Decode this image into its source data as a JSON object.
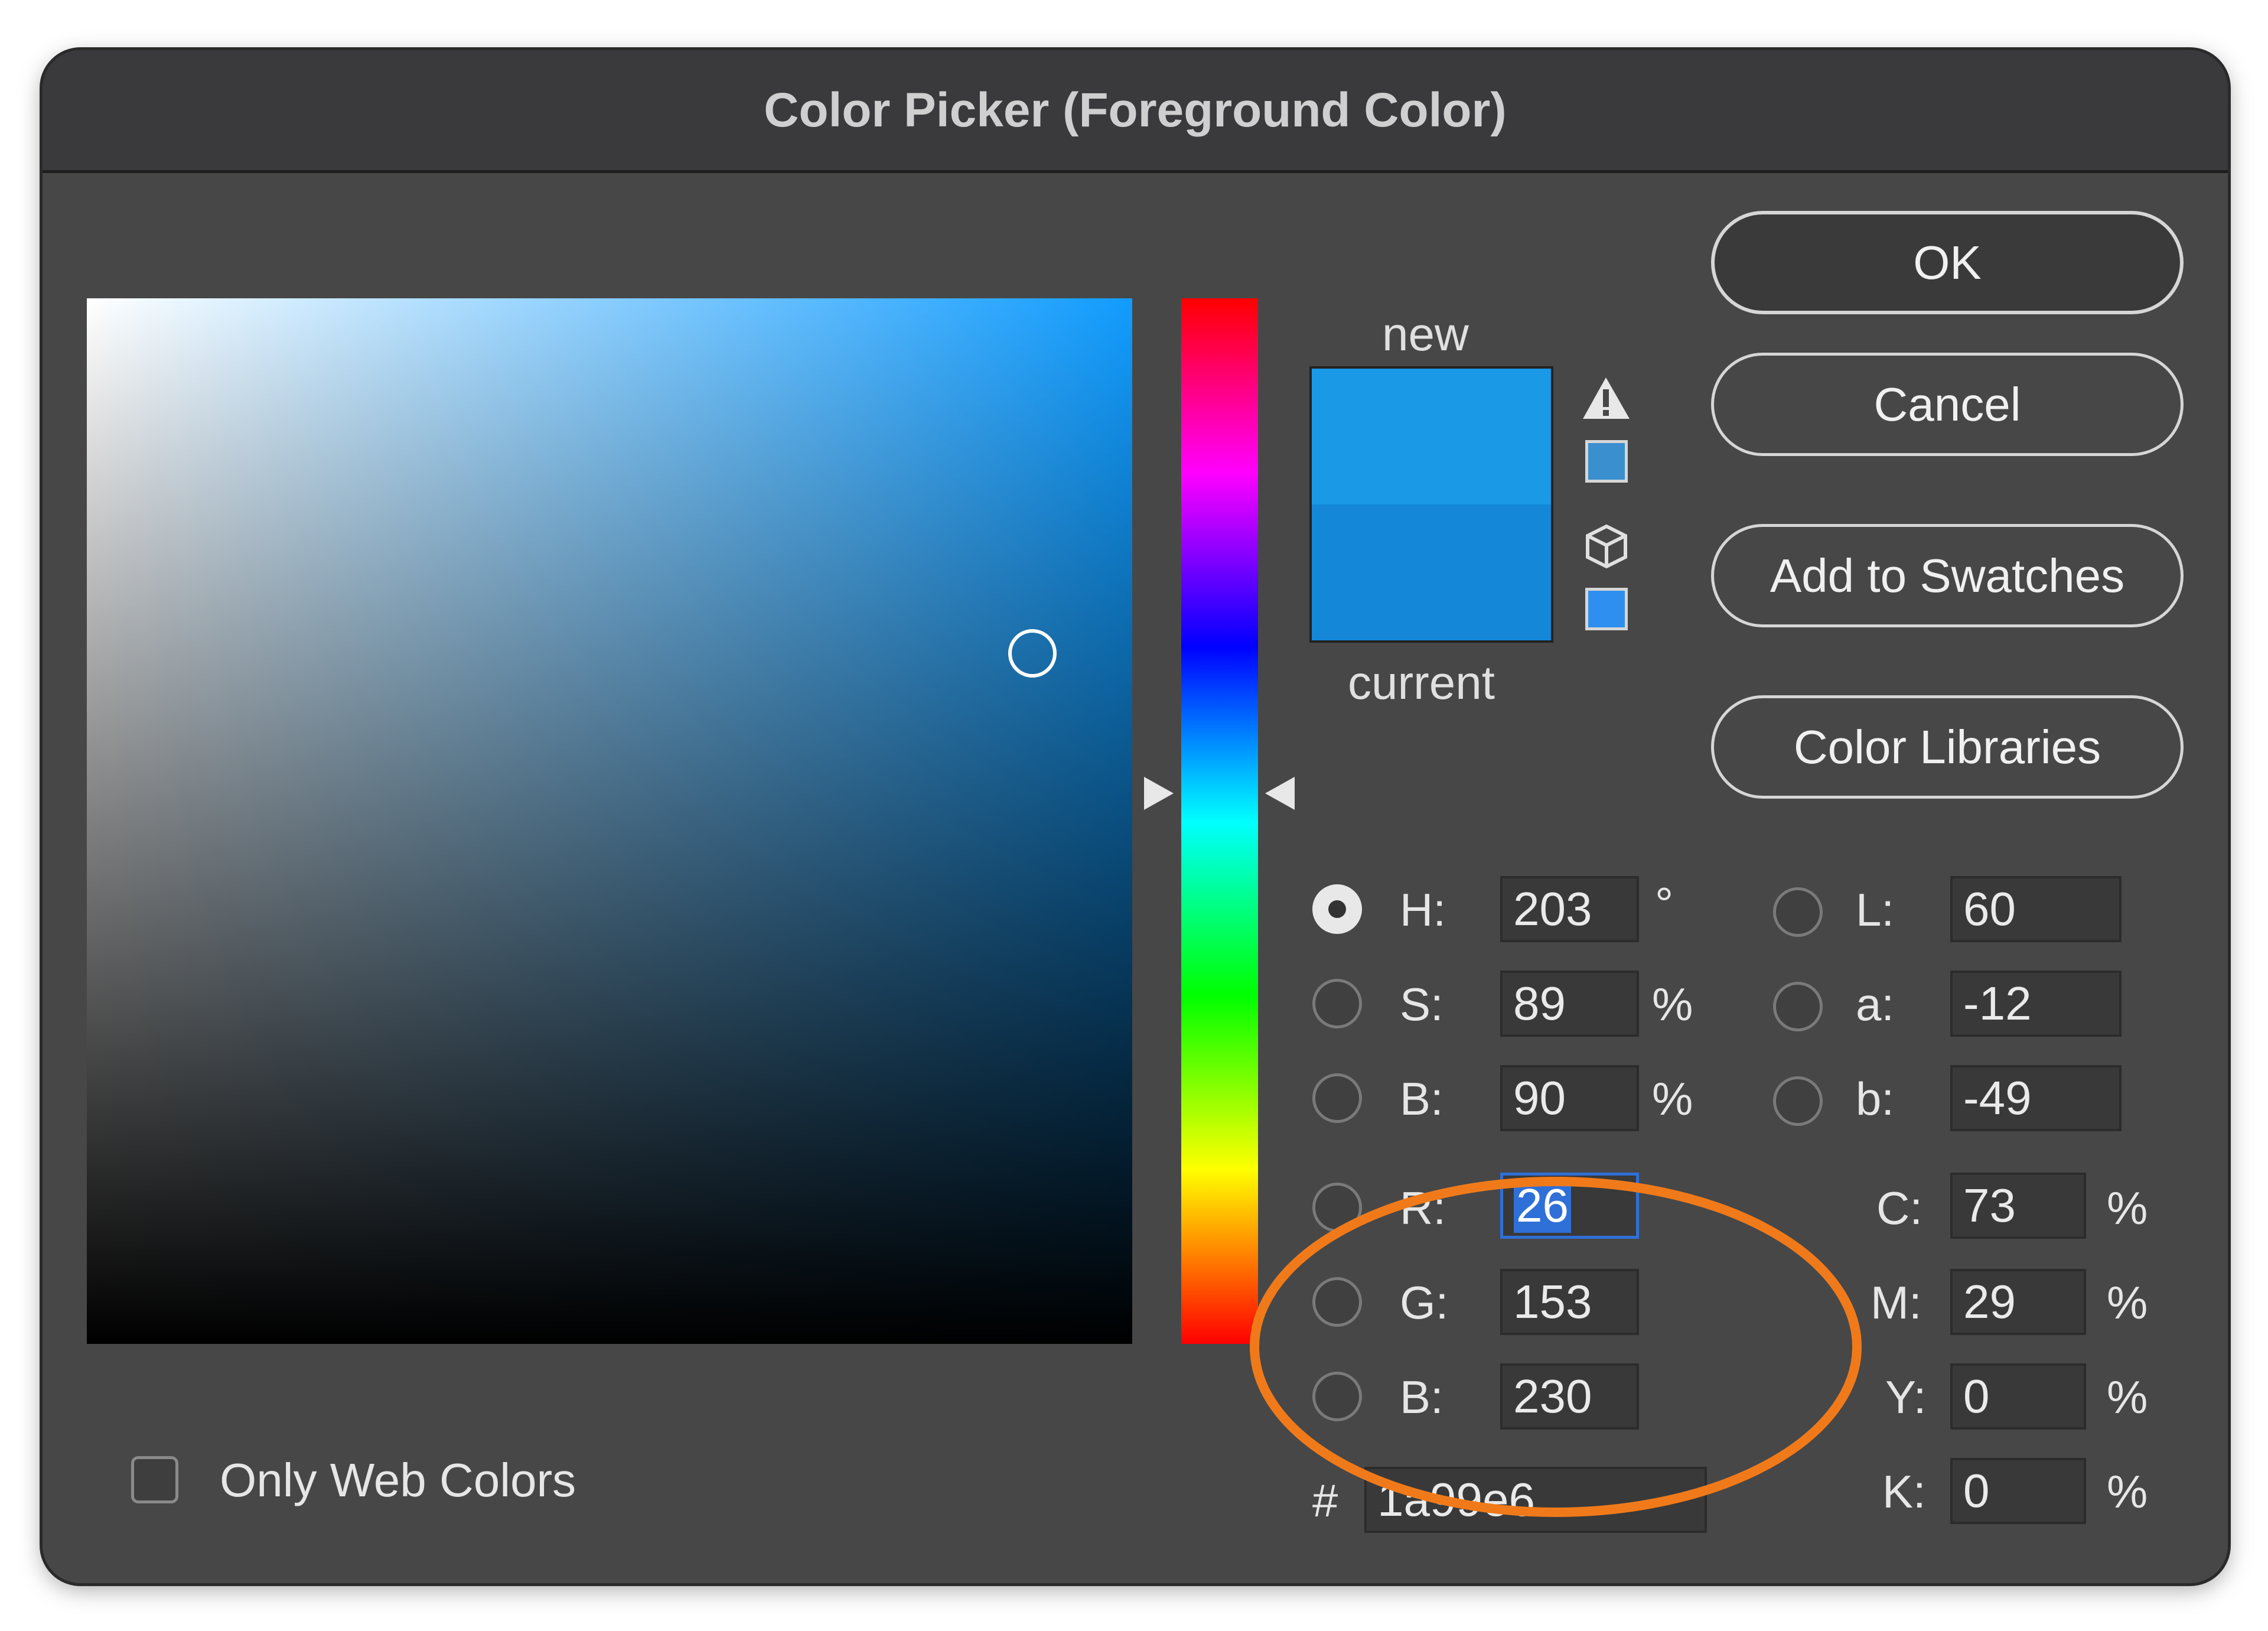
{
  "dialog": {
    "title": "Color Picker (Foreground Color)"
  },
  "preview": {
    "new_label": "new",
    "current_label": "current",
    "new_color": "#1a99e6",
    "current_color": "#1487d9"
  },
  "alerts": {
    "gamut_swatch_color": "#3a8fcf",
    "web_swatch_color": "#2f8ff0"
  },
  "buttons": {
    "ok": "OK",
    "cancel": "Cancel",
    "add_to_swatches": "Add to Swatches",
    "color_libraries": "Color Libraries"
  },
  "hsb": {
    "h_label": "H:",
    "h_value": "203",
    "h_unit": "°",
    "s_label": "S:",
    "s_value": "89",
    "s_unit": "%",
    "b_label": "B:",
    "b_value": "90",
    "b_unit": "%"
  },
  "rgb": {
    "r_label": "R:",
    "r_value": "26",
    "g_label": "G:",
    "g_value": "153",
    "b_label": "B:",
    "b_value": "230"
  },
  "lab": {
    "l_label": "L:",
    "l_value": "60",
    "a_label": "a:",
    "a_value": "-12",
    "b_label": "b:",
    "b_value": "-49"
  },
  "cmyk": {
    "c_label": "C:",
    "c_value": "73",
    "m_label": "M:",
    "m_value": "29",
    "y_label": "Y:",
    "y_value": "0",
    "k_label": "K:",
    "k_value": "0",
    "unit": "%"
  },
  "hex": {
    "label": "#",
    "value": "1a99e6"
  },
  "options": {
    "only_web_colors": "Only Web Colors"
  },
  "annotation": {
    "color": "#f07a1a"
  }
}
